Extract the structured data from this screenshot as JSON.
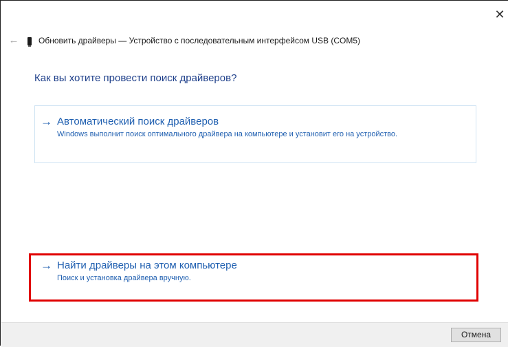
{
  "window": {
    "title": "Обновить драйверы — Устройство с последовательным интерфейсом USB (COM5)",
    "close_glyph": "✕",
    "back_glyph": "←"
  },
  "main": {
    "heading": "Как вы хотите провести поиск драйверов?",
    "options": [
      {
        "arrow": "→",
        "title": "Автоматический поиск драйверов",
        "description": "Windows выполнит поиск оптимального драйвера на компьютере и установит его на устройство."
      },
      {
        "arrow": "→",
        "title": "Найти драйверы на этом компьютере",
        "description": "Поиск и установка драйвера вручную."
      }
    ]
  },
  "footer": {
    "cancel_label": "Отмена"
  },
  "colors": {
    "accent": "#1f5fb0",
    "heading": "#1e3f8a",
    "highlight": "#e00000"
  },
  "icons": [
    "close-icon",
    "back-arrow-icon",
    "usb-device-icon",
    "arrow-right-icon"
  ]
}
